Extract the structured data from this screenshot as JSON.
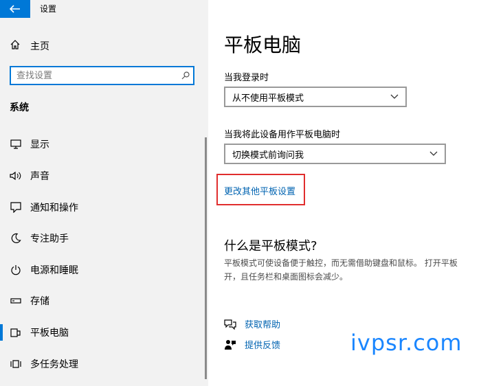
{
  "window": {
    "title": "设置",
    "back_label": "←"
  },
  "sidebar": {
    "home_label": "主页",
    "search_placeholder": "查找设置",
    "section_label": "系统",
    "items": [
      {
        "label": "显示",
        "icon": "monitor-icon"
      },
      {
        "label": "声音",
        "icon": "speaker-icon"
      },
      {
        "label": "通知和操作",
        "icon": "notification-icon"
      },
      {
        "label": "专注助手",
        "icon": "moon-icon"
      },
      {
        "label": "电源和睡眠",
        "icon": "power-icon"
      },
      {
        "label": "存储",
        "icon": "storage-icon"
      },
      {
        "label": "平板电脑",
        "icon": "tablet-icon",
        "selected": true
      },
      {
        "label": "多任务处理",
        "icon": "multitask-icon"
      }
    ]
  },
  "main": {
    "title": "平板电脑",
    "signin_label": "当我登录时",
    "signin_value": "从不使用平板模式",
    "tablet_use_label": "当我将此设备用作平板电脑时",
    "tablet_use_value": "切换模式前询问我",
    "more_settings_link": "更改其他平板设置",
    "what_is_heading": "什么是平板模式?",
    "description_line1": "平板模式可使设备便于触控，而无需借助键盘和鼠标。 打开平板",
    "description_line2": "开，且任务栏和桌面图标会减少。",
    "get_help": "获取帮助",
    "give_feedback": "提供反馈"
  },
  "watermark": "ivpsr.com",
  "colors": {
    "accent": "#0078d7",
    "highlight_box": "#e02d2d",
    "link": "#0063b1"
  }
}
